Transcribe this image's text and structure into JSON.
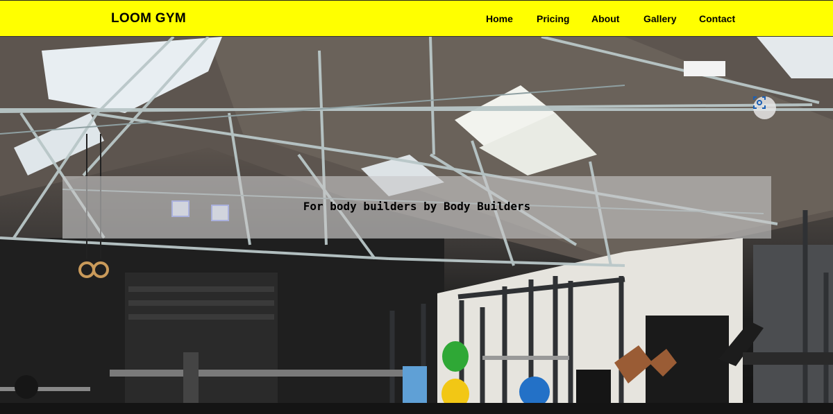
{
  "brand": {
    "name": "LOOM GYM"
  },
  "nav": {
    "items": [
      {
        "label": "Home"
      },
      {
        "label": "Pricing"
      },
      {
        "label": "About"
      },
      {
        "label": "Gallery"
      },
      {
        "label": "Contact"
      }
    ]
  },
  "hero": {
    "tagline": "For body builders by Body Builders",
    "image_subject": "gym-interior-photo"
  },
  "overlay": {
    "icon": "visual-search-icon"
  },
  "colors": {
    "navbar_bg": "#ffff00",
    "text": "#000000",
    "tagline_band": "rgba(200,200,200,0.62)"
  }
}
